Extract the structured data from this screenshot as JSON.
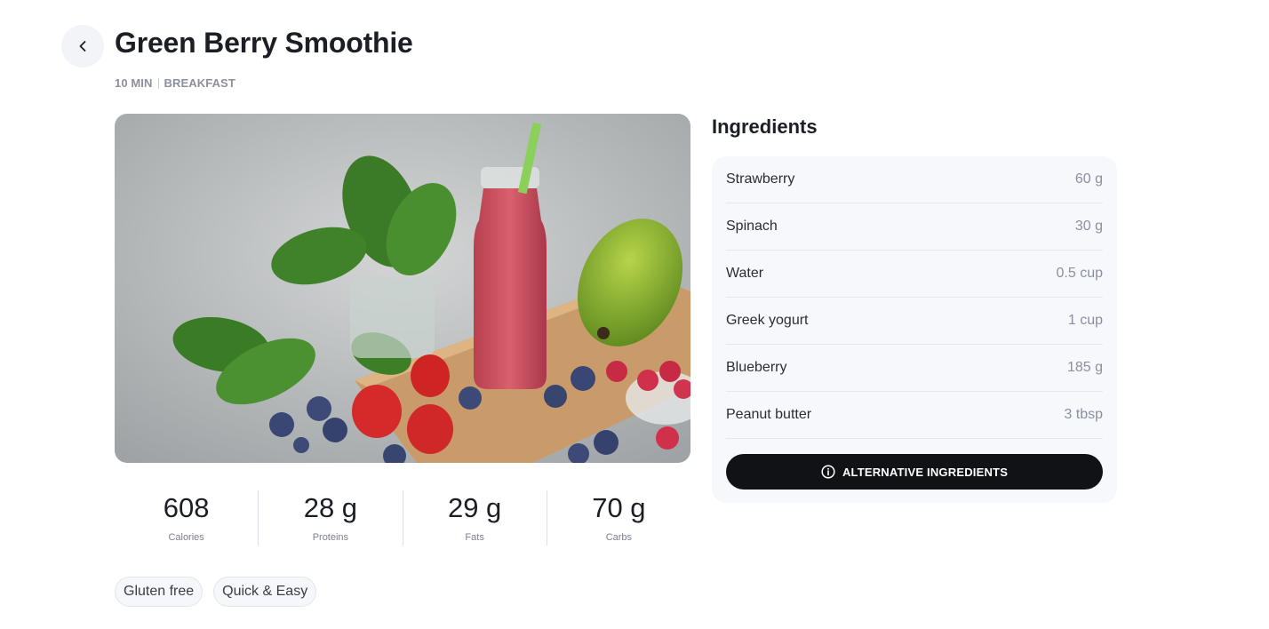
{
  "header": {
    "title": "Green Berry Smoothie",
    "time": "10 MIN",
    "category": "BREAKFAST"
  },
  "nutrition": [
    {
      "value": "608",
      "label": "Calories"
    },
    {
      "value": "28 g",
      "label": "Proteins"
    },
    {
      "value": "29 g",
      "label": "Fats"
    },
    {
      "value": "70 g",
      "label": "Carbs"
    }
  ],
  "tags": [
    "Gluten free",
    "Quick & Easy"
  ],
  "ingredients": {
    "title": "Ingredients",
    "items": [
      {
        "name": "Strawberry",
        "qty": "60 g"
      },
      {
        "name": "Spinach",
        "qty": "30 g"
      },
      {
        "name": "Water",
        "qty": "0.5 cup"
      },
      {
        "name": "Greek yogurt",
        "qty": "1 cup"
      },
      {
        "name": "Blueberry",
        "qty": "185 g"
      },
      {
        "name": "Peanut butter",
        "qty": "3 tbsp"
      }
    ],
    "alt_button_label": "ALTERNATIVE INGREDIENTS"
  },
  "icons": {
    "back": "chevron-left-icon",
    "info": "info-circle-icon"
  },
  "colors": {
    "button_dark": "#111216",
    "card_bg": "#f7f8fb",
    "muted_text": "#8b90a0"
  }
}
